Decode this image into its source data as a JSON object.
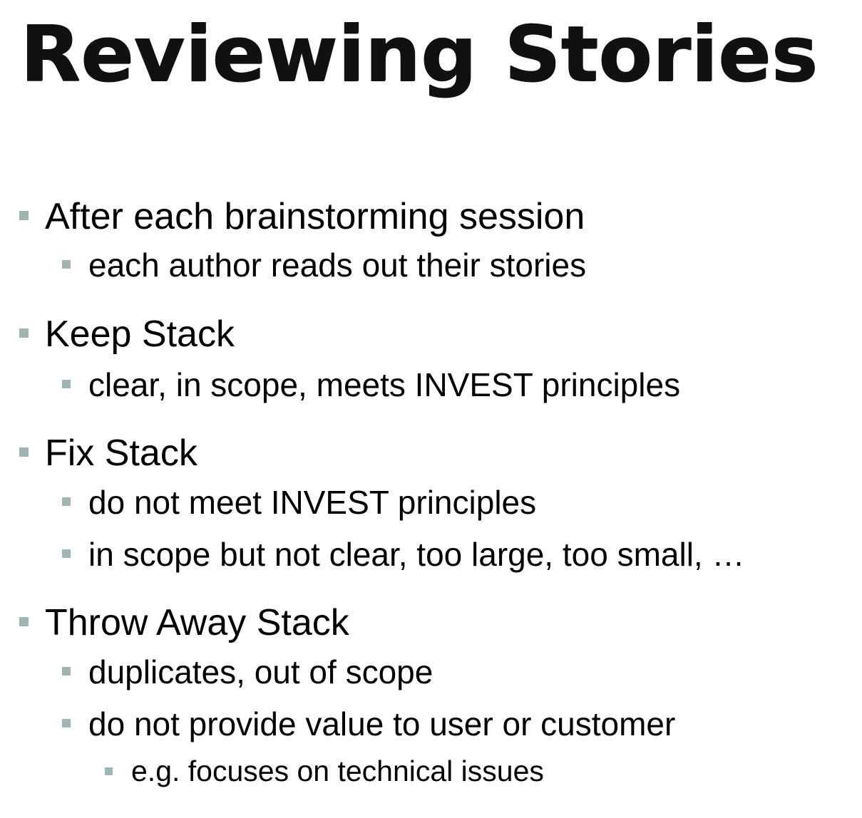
{
  "slide": {
    "title": "Reviewing Stories",
    "bullets": [
      {
        "text": "After each brainstorming session",
        "children": [
          {
            "text": "each author reads out their stories"
          }
        ]
      },
      {
        "text": "Keep Stack",
        "children": [
          {
            "text": "clear, in scope, meets INVEST principles"
          }
        ]
      },
      {
        "text": "Fix Stack",
        "children": [
          {
            "text": "do not meet INVEST principles"
          },
          {
            "text": "in scope but not clear, too large, too small, …"
          }
        ]
      },
      {
        "text": "Throw Away Stack",
        "children": [
          {
            "text": "duplicates, out of scope"
          },
          {
            "text": "do not provide value to user or customer",
            "children": [
              {
                "text": "e.g. focuses on technical issues"
              }
            ]
          }
        ]
      }
    ]
  },
  "colors": {
    "bullet_marker": "#9fb4b4",
    "title": "#111111",
    "text": "#000000"
  }
}
